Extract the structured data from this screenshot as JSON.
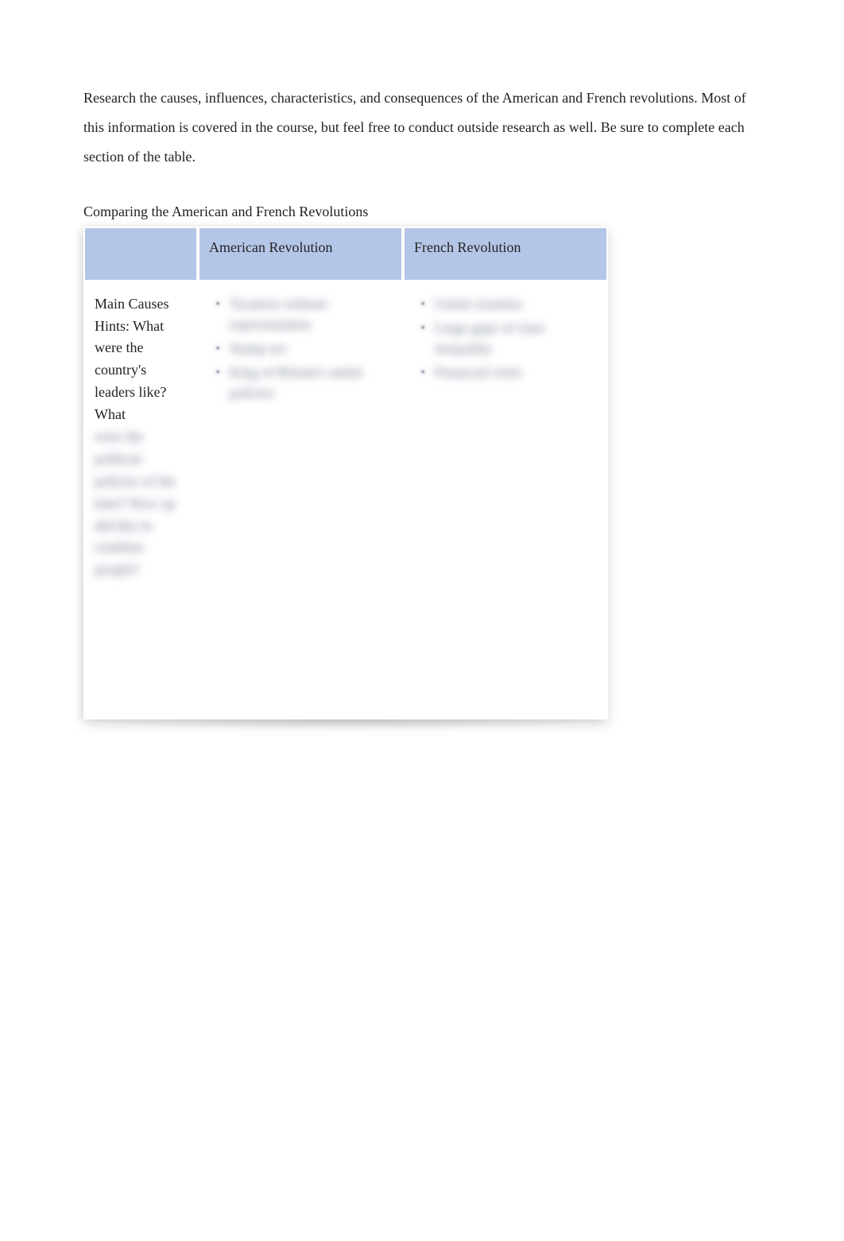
{
  "instructions": "Research the causes, influences, characteristics, and consequences of the American and French revolutions. Most of this information is covered in the course, but feel free to conduct outside research as well. Be sure to complete each section of the table.",
  "tableCaption": "Comparing the American and French Revolutions",
  "columns": {
    "corner": "",
    "american": "American Revolution",
    "french": "French Revolution"
  },
  "rowHeader": {
    "title": "Main Causes",
    "hintsClear": "Hints: What were the country's leaders like? What",
    "hintsBlurred": "were the political policies of the time? How up did this in combine people?"
  },
  "americanCauses": [
    "Taxation without representation",
    "Stamp act",
    "King of Britain's unfair policies"
  ],
  "frenchCauses": [
    "Unfair taxation",
    "Large gaps of class inequality",
    "Financial crisis"
  ]
}
